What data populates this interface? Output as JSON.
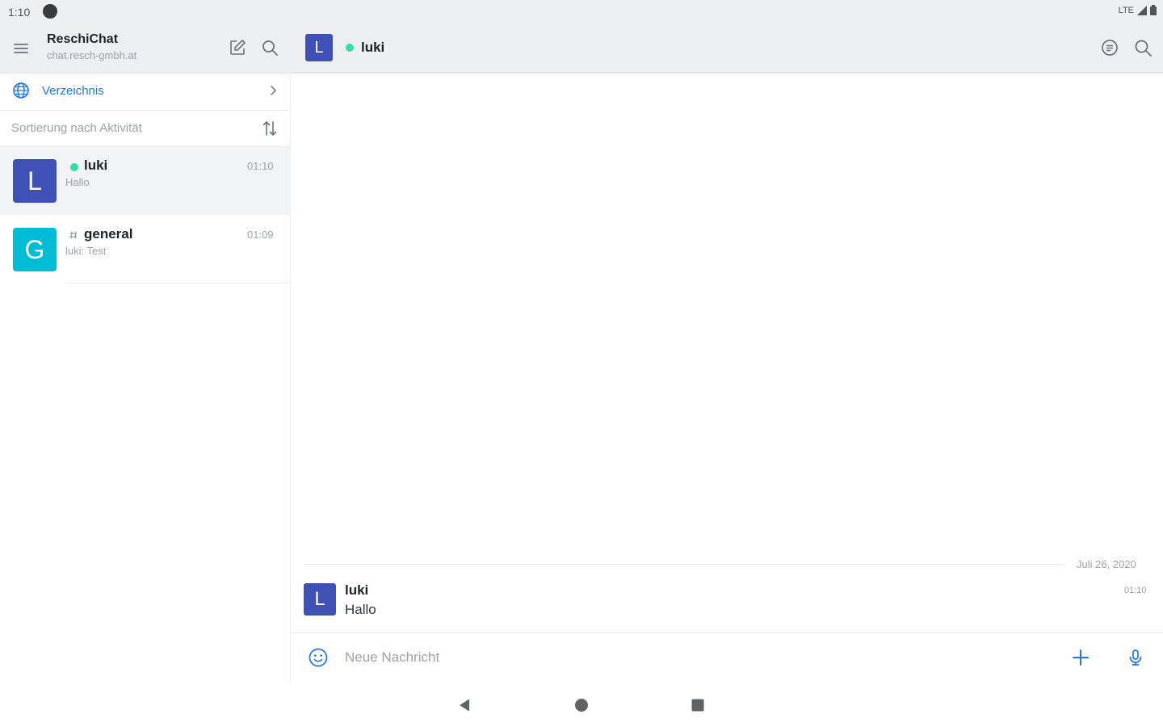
{
  "status_bar": {
    "time": "1:10",
    "network": "LTE"
  },
  "server": {
    "name": "ReschiChat",
    "url": "chat.resch-gmbh.at"
  },
  "directory": {
    "label": "Verzeichnis"
  },
  "sort": {
    "label": "Sortierung nach Aktivität"
  },
  "rooms": [
    {
      "avatar_letter": "L",
      "avatar_color": "#3f51b5",
      "name": "luki",
      "last_message": "Hallo",
      "time": "01:10",
      "type": "direct",
      "status": "online",
      "active": true
    },
    {
      "avatar_letter": "G",
      "avatar_color": "#00bcd4",
      "name": "general",
      "last_message": "luki: Test",
      "time": "01:09",
      "type": "channel",
      "active": false
    }
  ],
  "current_room": {
    "avatar_letter": "L",
    "name": "luki",
    "status": "online"
  },
  "messages": {
    "date_separator": "Juli 26, 2020",
    "items": [
      {
        "avatar_letter": "L",
        "author": "luki",
        "text": "Hallo",
        "time": "01:10"
      }
    ]
  },
  "composer": {
    "placeholder": "Neue Nachricht"
  },
  "colors": {
    "accent": "#1d74f5",
    "online": "#2de0a5",
    "header_bg": "#eeeff1"
  },
  "icons": [
    "hamburger-icon",
    "compose-icon",
    "search-icon",
    "globe-icon",
    "chevron-right-icon",
    "sort-icon",
    "threads-icon",
    "emoji-icon",
    "plus-icon",
    "mic-icon",
    "nav-back-icon",
    "nav-home-icon",
    "nav-recent-icon"
  ]
}
